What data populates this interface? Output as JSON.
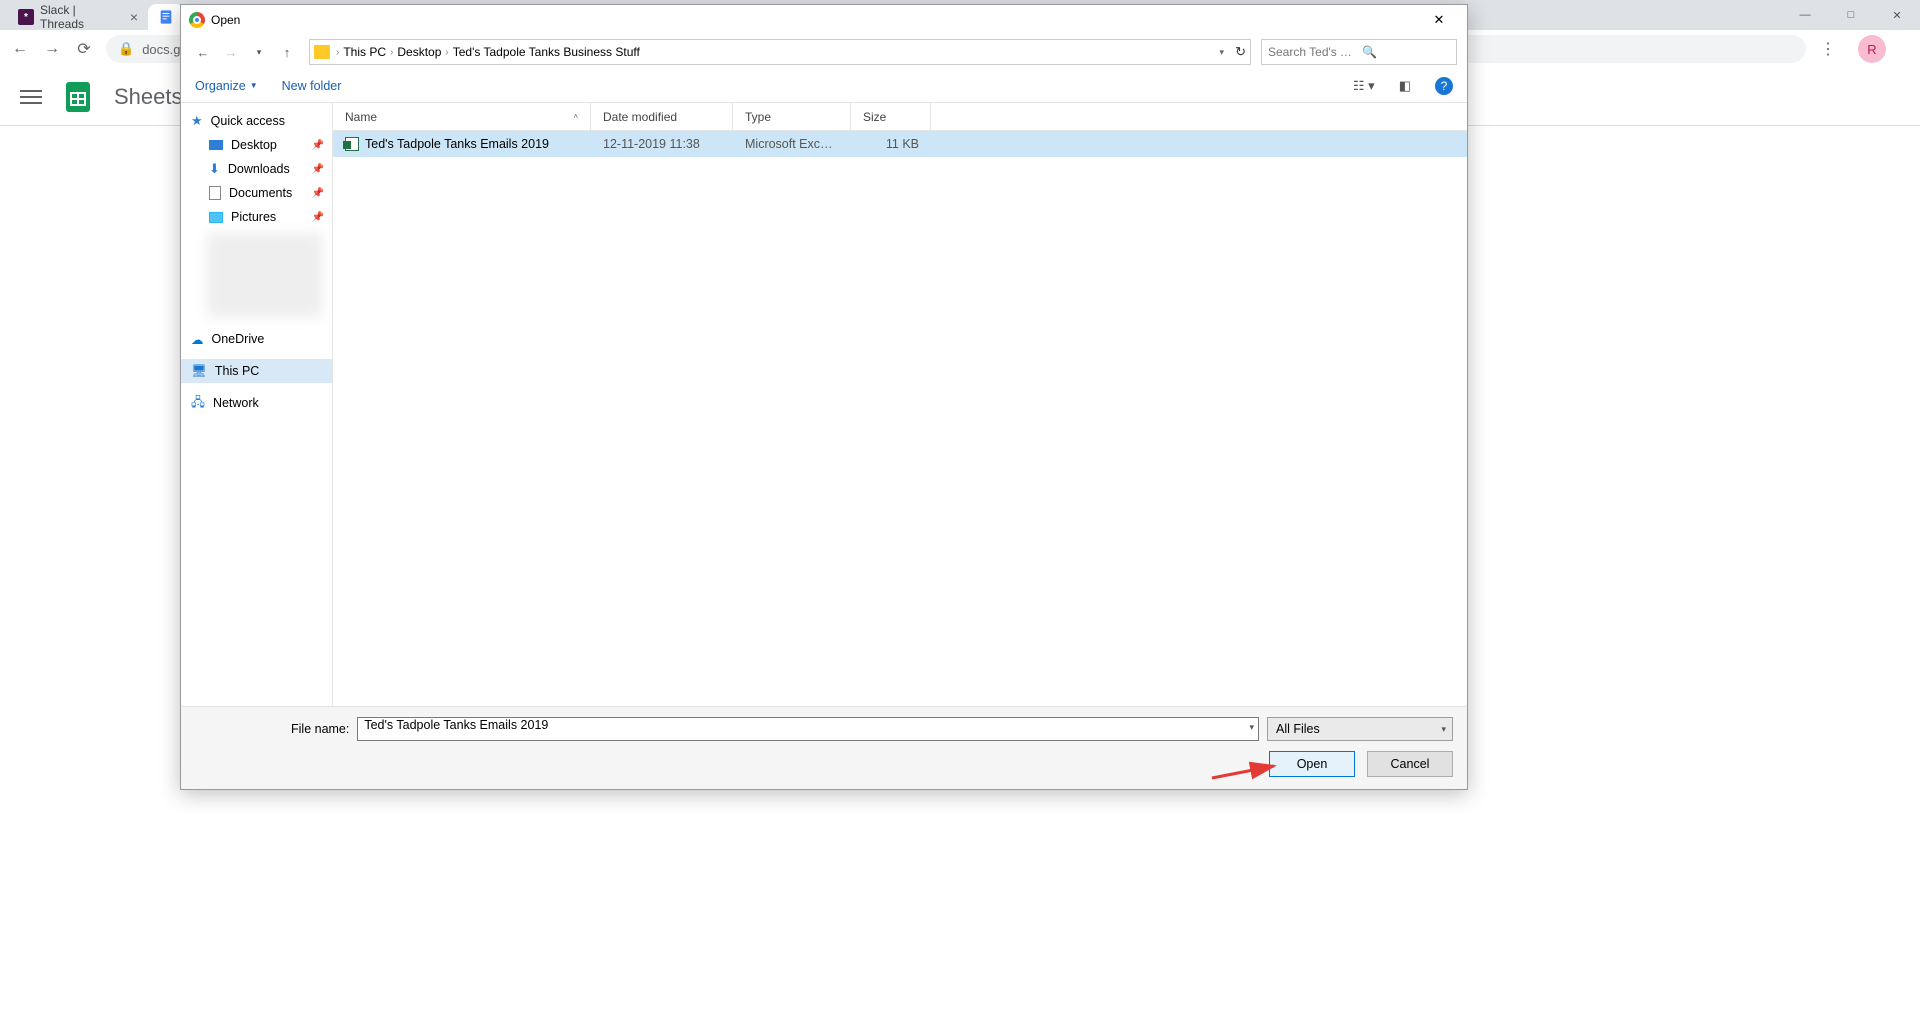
{
  "chrome": {
    "tabs": [
      {
        "label": "Slack | Threads"
      },
      {
        "label": ""
      }
    ],
    "url_host": "docs.g",
    "sheets_title": "Sheets",
    "avatar_initial": "R"
  },
  "dialog": {
    "title": "Open",
    "nav": {
      "crumbs": [
        "This PC",
        "Desktop",
        "Ted's Tadpole Tanks Business Stuff"
      ],
      "search_placeholder": "Search Ted's Tadpole Tanks Bu..."
    },
    "toolbar": {
      "organize": "Organize",
      "new_folder": "New folder"
    },
    "navpane": {
      "quick_access": "Quick access",
      "desktop": "Desktop",
      "downloads": "Downloads",
      "documents": "Documents",
      "pictures": "Pictures",
      "onedrive": "OneDrive",
      "this_pc": "This PC",
      "network": "Network"
    },
    "columns": {
      "name": "Name",
      "date": "Date modified",
      "type": "Type",
      "size": "Size"
    },
    "files": [
      {
        "name": "Ted's Tadpole Tanks Emails 2019",
        "date": "12-11-2019 11:38",
        "type": "Microsoft Excel W...",
        "size": "11 KB"
      }
    ],
    "bottom": {
      "filename_label": "File name:",
      "filename_value": "Ted's Tadpole Tanks Emails 2019",
      "filter": "All Files",
      "open": "Open",
      "cancel": "Cancel"
    }
  }
}
